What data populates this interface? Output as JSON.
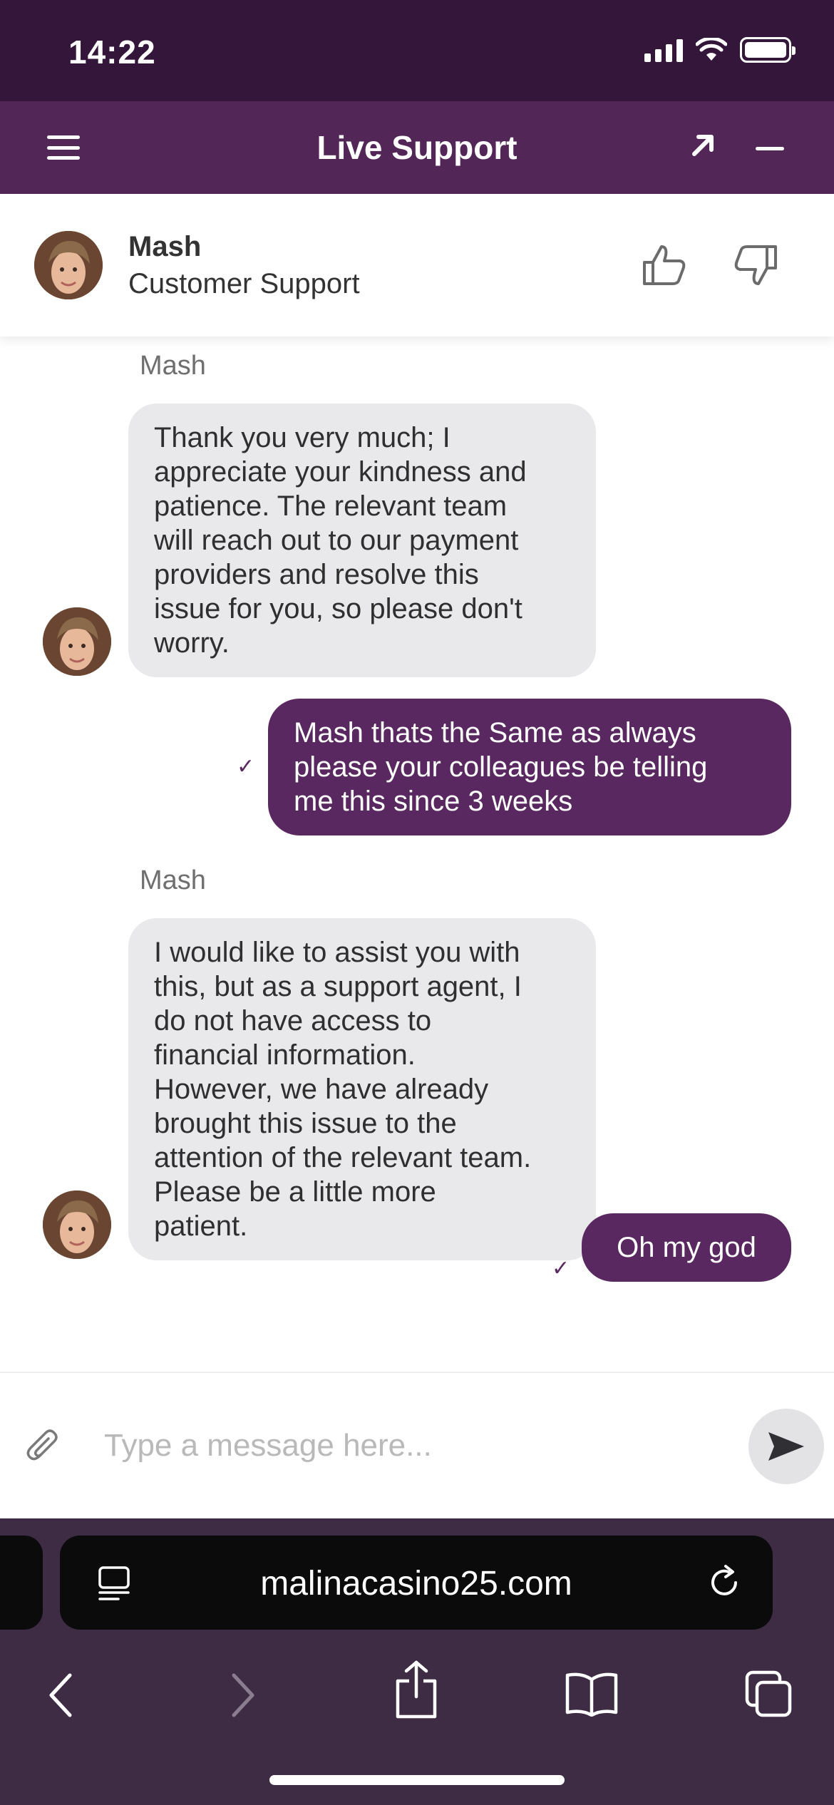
{
  "status_bar": {
    "time": "14:22"
  },
  "header": {
    "title": "Live Support",
    "menu_icon": "hamburger-menu-icon",
    "expand_icon": "expand-arrow-icon",
    "minimize_icon": "minimize-icon"
  },
  "agent": {
    "name": "Mash",
    "role": "Customer Support",
    "rate_up_icon": "thumbs-up-icon",
    "rate_down_icon": "thumbs-down-icon"
  },
  "messages": [
    {
      "direction": "incoming",
      "sender": "Mash",
      "lines": [
        "Thank you very much; I",
        "appreciate your kindness and",
        "patience. The relevant team",
        "will reach out to our payment",
        "providers and resolve this",
        "issue for you, so please don't",
        "worry."
      ]
    },
    {
      "direction": "outgoing",
      "status": "✓",
      "lines": [
        "Mash thats the Same as always",
        "please your colleagues be telling",
        "me this since 3 weeks"
      ]
    },
    {
      "direction": "incoming",
      "sender": "Mash",
      "lines": [
        "I would like to assist you with",
        "this, but as a support agent, I",
        "do not have access to",
        "financial information.",
        "However, we have already",
        "brought this issue to the",
        "attention of the relevant team.",
        "Please be a little more",
        "patient."
      ]
    },
    {
      "direction": "outgoing",
      "status": "✓",
      "lines": [
        "Oh my god"
      ]
    }
  ],
  "composer": {
    "placeholder": "Type a message here...",
    "value": "",
    "attach_icon": "paperclip-icon",
    "send_icon": "send-icon"
  },
  "browser": {
    "url": "malinacasino25.com",
    "page_menu_icon": "page-menu-icon",
    "reload_icon": "reload-icon",
    "toolbar": [
      "back-icon",
      "forward-icon",
      "share-icon",
      "bookmarks-icon",
      "tabs-icon"
    ]
  },
  "colors": {
    "status_bar_bg": "#33163a",
    "header_bg": "#532658",
    "outgoing_bubble": "#5a2860",
    "incoming_bubble": "#e9e9ec",
    "browser_bg": "#3e2c45"
  }
}
